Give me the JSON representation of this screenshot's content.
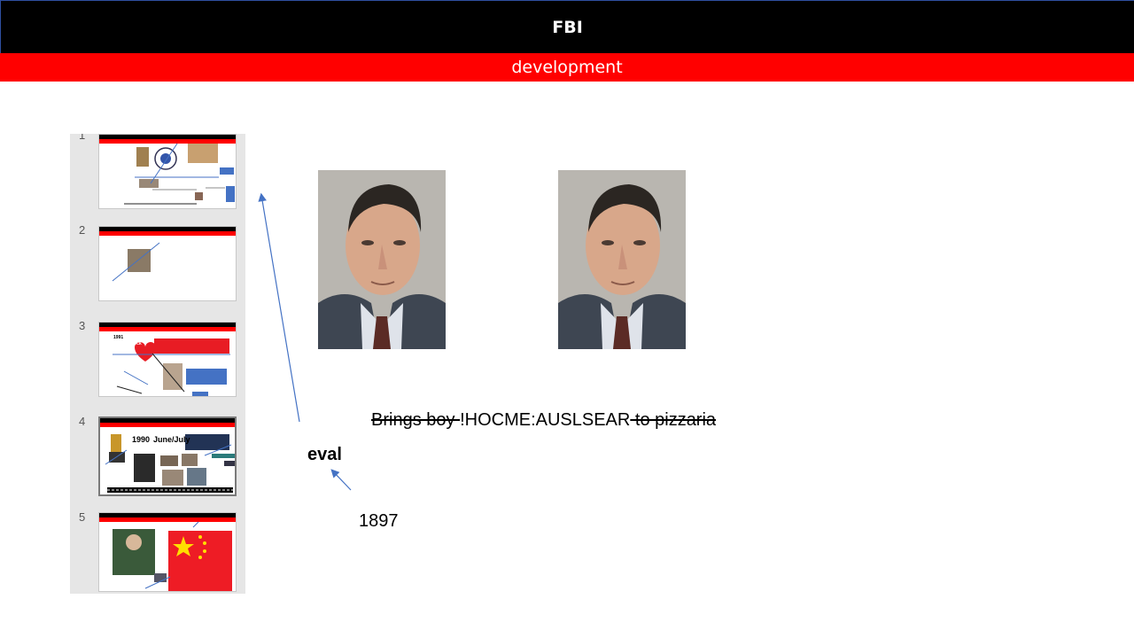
{
  "header": {
    "title": "FBI",
    "subtitle": "development"
  },
  "thumbnails": [
    {
      "number": "1",
      "year_text": "",
      "title_text": ""
    },
    {
      "number": "2",
      "year_text": "",
      "title_text": ""
    },
    {
      "number": "3",
      "year_text": "1991",
      "title_text": "Lock"
    },
    {
      "number": "4",
      "year_text": "1990",
      "title_text": "June/July"
    },
    {
      "number": "5",
      "year_text": "",
      "title_text": ""
    }
  ],
  "slide": {
    "strike_part1": "Brings boy ",
    "highlight": "!HOCME:AUSLSEAR",
    "strike_part2": " to pizzaria",
    "eval": "eval",
    "year": "1897"
  },
  "colors": {
    "header_black": "#000000",
    "header_red": "#ff0000",
    "arrow": "#4472c4"
  }
}
